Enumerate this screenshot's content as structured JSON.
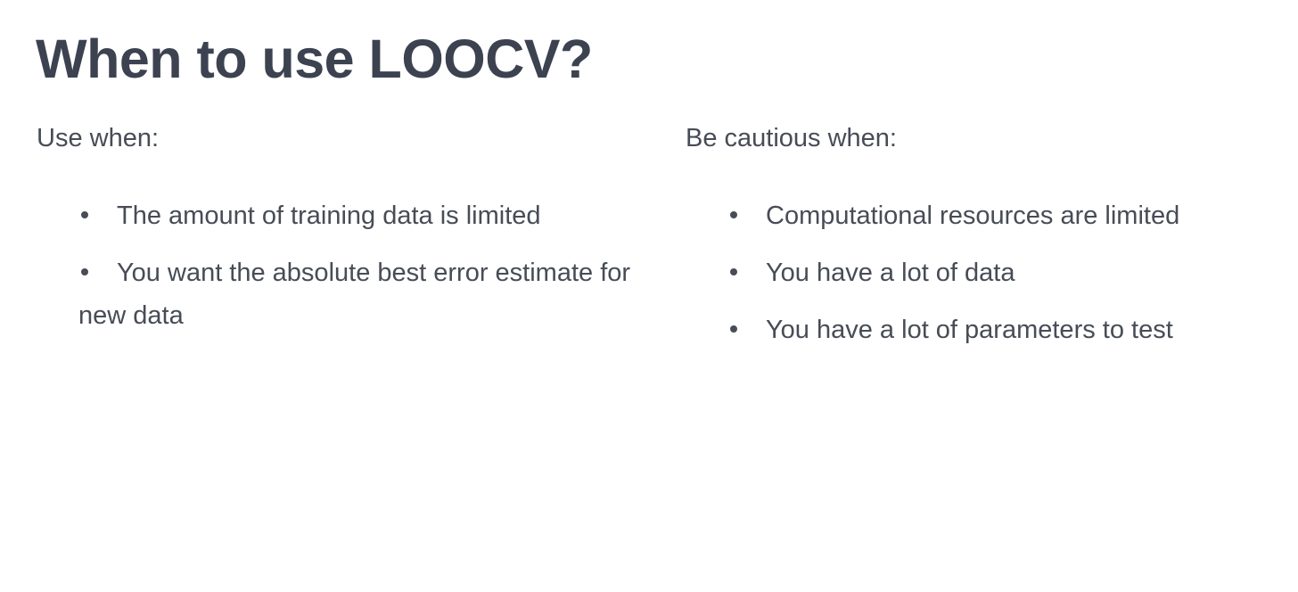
{
  "title": "When to use LOOCV?",
  "left": {
    "heading": "Use when:",
    "items": [
      "The amount of training data is limited",
      "You want the absolute best error estimate for new data"
    ]
  },
  "right": {
    "heading": "Be cautious when:",
    "items": [
      "Computational resources are limited",
      "You have a lot of data",
      "You have a lot of parameters to test"
    ]
  }
}
